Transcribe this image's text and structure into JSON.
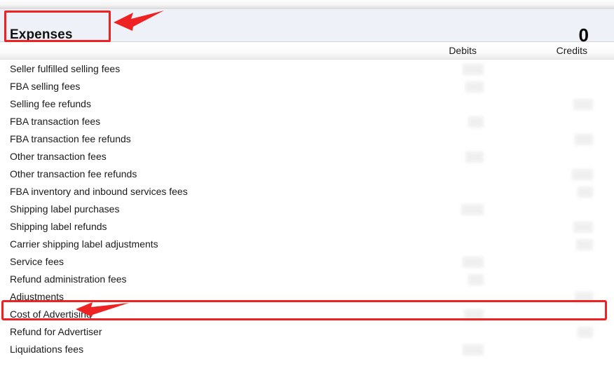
{
  "panel": {
    "title": "Expenses",
    "total_value": "0",
    "accent_color": "#ee2222",
    "header_background": "#eef2f8"
  },
  "columns": {
    "debits_label": "Debits",
    "credits_label": "Credits"
  },
  "rows": [
    {
      "label": "Seller fulfilled selling fees",
      "debits_redacted": true,
      "credits_redacted": false
    },
    {
      "label": "FBA selling fees",
      "debits_redacted": true,
      "credits_redacted": false
    },
    {
      "label": "Selling fee refunds",
      "debits_redacted": false,
      "credits_redacted": true
    },
    {
      "label": "FBA transaction fees",
      "debits_redacted": true,
      "credits_redacted": false
    },
    {
      "label": "FBA transaction fee refunds",
      "debits_redacted": false,
      "credits_redacted": true
    },
    {
      "label": "Other transaction fees",
      "debits_redacted": true,
      "credits_redacted": false
    },
    {
      "label": "Other transaction fee refunds",
      "debits_redacted": false,
      "credits_redacted": true
    },
    {
      "label": "FBA inventory and inbound services fees",
      "debits_redacted": false,
      "credits_redacted": true
    },
    {
      "label": "Shipping label purchases",
      "debits_redacted": true,
      "credits_redacted": false
    },
    {
      "label": "Shipping label refunds",
      "debits_redacted": false,
      "credits_redacted": true
    },
    {
      "label": "Carrier shipping label adjustments",
      "debits_redacted": false,
      "credits_redacted": true
    },
    {
      "label": "Service fees",
      "debits_redacted": true,
      "credits_redacted": false
    },
    {
      "label": "Refund administration fees",
      "debits_redacted": true,
      "credits_redacted": false
    },
    {
      "label": "Adjustments",
      "debits_redacted": false,
      "credits_redacted": true
    },
    {
      "label": "Cost of Advertising",
      "debits_redacted": true,
      "credits_redacted": false
    },
    {
      "label": "Refund for Advertiser",
      "debits_redacted": false,
      "credits_redacted": true
    },
    {
      "label": "Liquidations fees",
      "debits_redacted": true,
      "credits_redacted": false
    }
  ],
  "annotations": [
    {
      "name": "expenses-title-highlight",
      "target": "Expenses"
    },
    {
      "name": "adjustments-row-highlight",
      "target": "Adjustments"
    }
  ]
}
